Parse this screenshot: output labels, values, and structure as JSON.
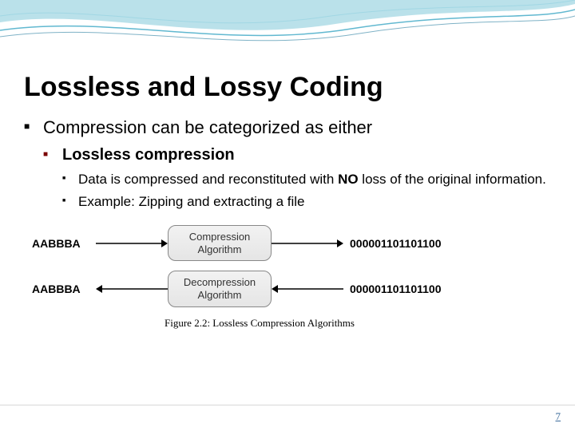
{
  "slide": {
    "title": "Lossless and Lossy Coding",
    "bullet1": "Compression can be categorized as either",
    "bullet2": "Lossless compression",
    "bullet3a_pre": "Data is compressed and reconstituted with ",
    "bullet3a_bold": "NO",
    "bullet3a_post": " loss of the original information.",
    "bullet3b": "Example: Zipping and extracting a file"
  },
  "diagram": {
    "input": "AABBBA",
    "box1_line1": "Compression",
    "box1_line2": "Algorithm",
    "output_bits": "000001101101100",
    "box2_line1": "Decompression",
    "box2_line2": "Algorithm",
    "caption": "Figure 2.2: Lossless Compression Algorithms"
  },
  "page": "7"
}
